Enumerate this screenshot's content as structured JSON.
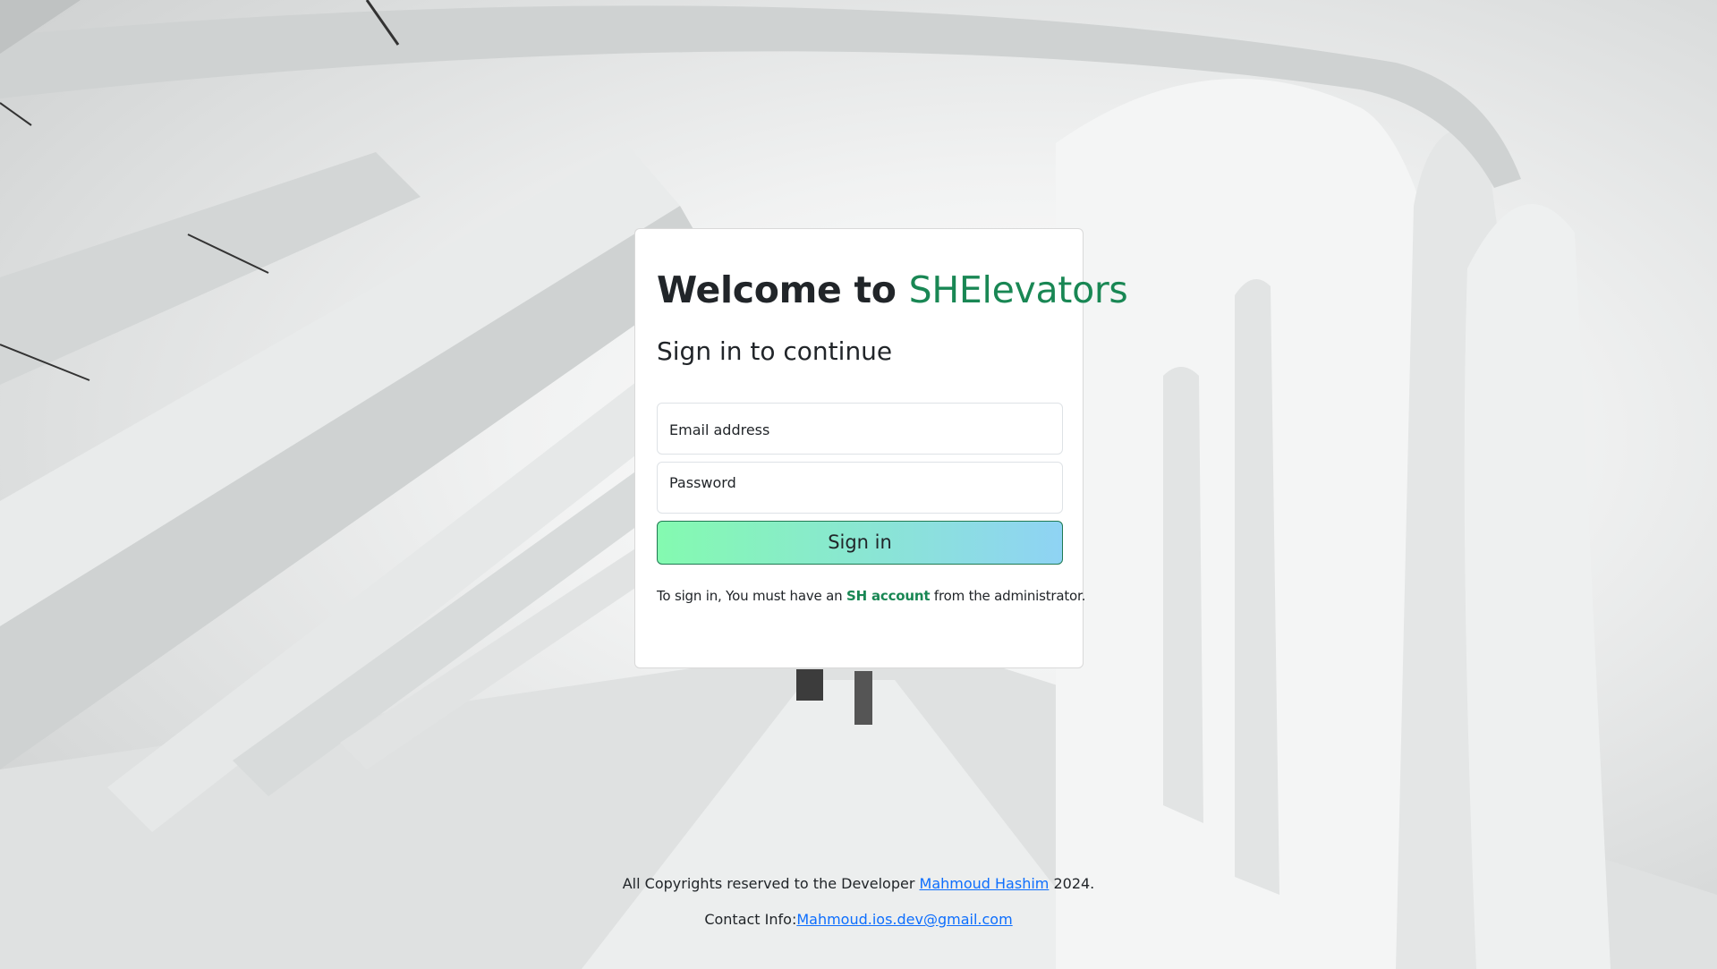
{
  "login": {
    "title_prefix": "Welcome to ",
    "title_brand": "SHElevators",
    "subtitle": "Sign in to continue",
    "email_label": "Email address",
    "password_label": "Password",
    "signin_button": "Sign in",
    "note_prefix": "To sign in, You must have an ",
    "note_account": "SH account",
    "note_suffix": " from the administrator."
  },
  "footer": {
    "copyright_prefix": "All Copyrights reserved to the Developer ",
    "developer_name": "Mahmoud Hashim",
    "copyright_suffix": " 2024.",
    "contact_prefix": "Contact Info:",
    "contact_email": "Mahmoud.ios.dev@gmail.com"
  },
  "colors": {
    "brand": "#198754",
    "link": "#0d6efd",
    "button_gradient_start": "#84fab0",
    "button_gradient_end": "#8fd3f4"
  }
}
